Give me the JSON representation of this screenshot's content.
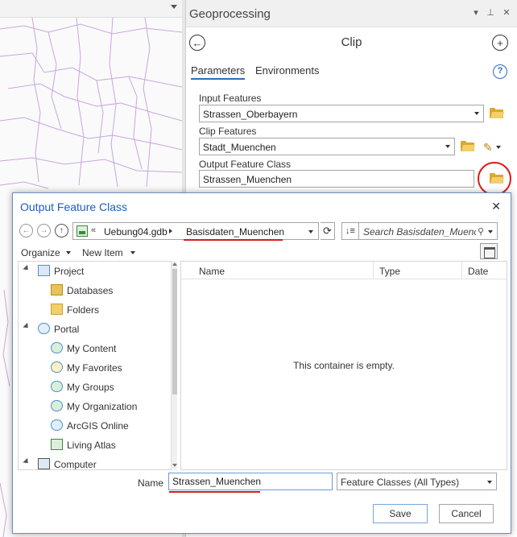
{
  "geoprocessing": {
    "pane_title": "Geoprocessing",
    "tool_title": "Clip",
    "tabs": [
      {
        "label": "Parameters"
      },
      {
        "label": "Environments"
      }
    ],
    "help": "?",
    "params": {
      "input_label": "Input Features",
      "input_value": "Strassen_Oberbayern",
      "clip_label": "Clip Features",
      "clip_value": "Stadt_Muenchen",
      "output_label": "Output Feature Class",
      "output_value": "Strassen_Muenchen"
    }
  },
  "dialog": {
    "title": "Output Feature Class",
    "address": {
      "prefix": "«",
      "segment1": "Uebung04.gdb",
      "segment2": "Basisdaten_Muenchen"
    },
    "search_placeholder": "Search Basisdaten_Muenchen",
    "toolbar": {
      "organize": "Organize",
      "new_item": "New Item"
    },
    "tree": [
      {
        "label": "Project",
        "icon": "project-icon"
      },
      {
        "label": "Databases",
        "icon": "databases-icon"
      },
      {
        "label": "Folders",
        "icon": "folders-icon"
      },
      {
        "label": "Portal",
        "icon": "portal-cloud-icon"
      },
      {
        "label": "My Content",
        "icon": "my-content-icon"
      },
      {
        "label": "My Favorites",
        "icon": "my-favorites-icon"
      },
      {
        "label": "My Groups",
        "icon": "my-groups-icon"
      },
      {
        "label": "My Organization",
        "icon": "my-organization-icon"
      },
      {
        "label": "ArcGIS Online",
        "icon": "arcgis-online-icon"
      },
      {
        "label": "Living Atlas",
        "icon": "living-atlas-icon"
      },
      {
        "label": "Computer",
        "icon": "computer-icon"
      }
    ],
    "columns": [
      "Name",
      "Type",
      "Date"
    ],
    "empty_message": "This container is empty.",
    "name_label": "Name",
    "name_value": "Strassen_Muenchen",
    "type_value": "Feature Classes (All Types)",
    "save_label": "Save",
    "cancel_label": "Cancel"
  },
  "colors": {
    "accent": "#2b6cbf",
    "annotation_red": "#d91a1a",
    "map_lines": "#c9a6e0"
  }
}
